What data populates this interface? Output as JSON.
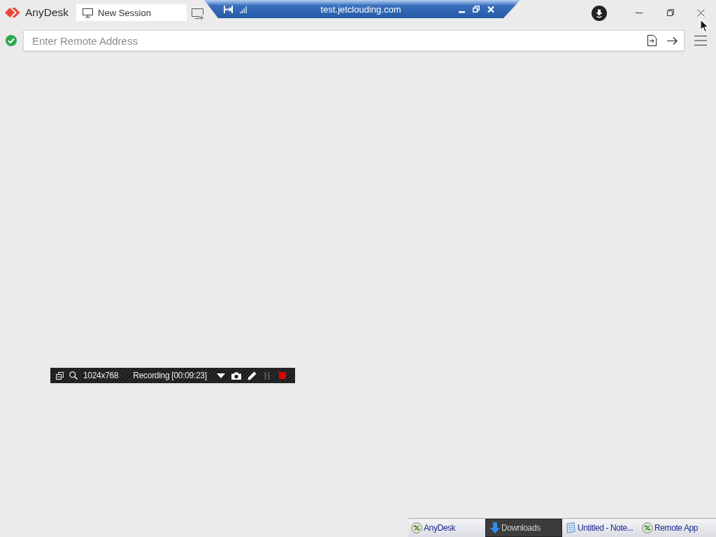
{
  "app": {
    "name": "AnyDesk"
  },
  "tabs": [
    {
      "label": "New Session",
      "selected": true
    }
  ],
  "remote_session": {
    "title": "test.jetclouding.com"
  },
  "address_bar": {
    "placeholder": "Enter Remote Address"
  },
  "session_toolbar": {
    "resolution": "1024x768",
    "recording": "Recording [00:09:23]",
    "buttons": [
      {
        "kind": "dropdown",
        "disabled": false
      },
      {
        "kind": "camera",
        "disabled": false
      },
      {
        "kind": "pencil",
        "disabled": false
      },
      {
        "kind": "pause",
        "disabled": true
      },
      {
        "kind": "stop",
        "disabled": false
      }
    ]
  },
  "taskbar": {
    "items": [
      {
        "label": "AnyDesk",
        "kind": "remote",
        "selected": false
      },
      {
        "label": "Downloads",
        "kind": "download",
        "selected": true
      },
      {
        "label": "Untitled - Note...",
        "kind": "notepad",
        "selected": false
      },
      {
        "label": "Remote App",
        "kind": "remote",
        "selected": false
      }
    ]
  }
}
